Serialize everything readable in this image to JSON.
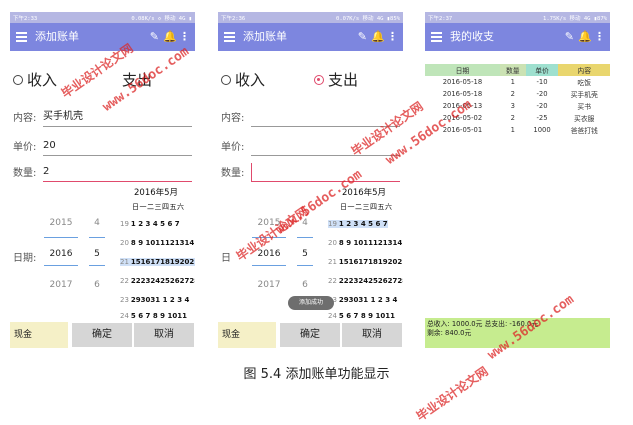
{
  "phone1": {
    "status": {
      "left": "下午2:33",
      "right": "0.08K/s ◇ 移动 4G ▮"
    },
    "title": "添加账单",
    "radio": {
      "income": "收入",
      "expense": "支出",
      "selected": "income"
    },
    "fields": {
      "content_label": "内容:",
      "content_value": "买手机壳",
      "price_label": "单价:",
      "price_value": "20",
      "qty_label": "数量:",
      "qty_value": "2"
    },
    "date_label": "日期:",
    "picker": {
      "years": [
        "2015",
        "2016",
        "2017"
      ],
      "months": [
        "4",
        "5",
        "6"
      ]
    },
    "calendar": {
      "title": "2016年5月",
      "head": "日一二三四五六",
      "rows": [
        [
          "19",
          "1 2 3 4 5 6 7"
        ],
        [
          "20",
          "8 9 1011121314"
        ],
        [
          "21",
          "15161718192021"
        ],
        [
          "22",
          "22232425262728"
        ],
        [
          "23",
          "293031 1 2 3 4"
        ],
        [
          "24",
          "5 6 7 8 9 1011"
        ]
      ]
    },
    "bottom": {
      "pay": "现金",
      "ok": "确定",
      "cancel": "取消"
    }
  },
  "phone2": {
    "status": {
      "left": "下午2:36",
      "right": "0.07K/s 移动 4G ▮85%"
    },
    "title": "添加账单",
    "radio": {
      "income": "收入",
      "expense": "支出",
      "selected": "expense"
    },
    "fields": {
      "content_label": "内容:",
      "price_label": "单价:",
      "qty_label": "数量:"
    },
    "date_label": "日",
    "picker": {
      "years": [
        "2015",
        "2016",
        "2017"
      ],
      "months": [
        "4",
        "5",
        "6"
      ]
    },
    "calendar": {
      "title": "2016年5月",
      "head": "日一二三四五六",
      "rows": [
        [
          "19",
          "1 2 3 4 5 6 7"
        ],
        [
          "20",
          "8 9 1011121314"
        ],
        [
          "21",
          "15161718192021"
        ],
        [
          "22",
          "22232425262728"
        ],
        [
          "23",
          "293031 1 2 3 4"
        ],
        [
          "24",
          "5 6 7 8 9 1011"
        ]
      ]
    },
    "toast": "添加成功",
    "bottom": {
      "pay": "现金",
      "ok": "确定",
      "cancel": "取消"
    }
  },
  "phone3": {
    "status": {
      "left": "下午2:37",
      "right": "1.75K/s 移动 4G ▮87%"
    },
    "title": "我的收支",
    "table": {
      "headers": [
        "日期",
        "数量",
        "单价",
        "内容"
      ],
      "rows": [
        [
          "2016-05-18",
          "1",
          "-10",
          "吃饭"
        ],
        [
          "2016-05-18",
          "2",
          "-20",
          "买手机壳"
        ],
        [
          "2016-05-13",
          "3",
          "-20",
          "买书"
        ],
        [
          "2016-05-02",
          "2",
          "-25",
          "买衣服"
        ],
        [
          "2016-05-01",
          "1",
          "1000",
          "爸爸打钱"
        ]
      ]
    },
    "summary": {
      "line1": "总收入: 1000.0元   总支出: -160.0元",
      "line2": "剩余: 840.0元"
    }
  },
  "caption": "图 5.4 添加账单功能显示",
  "watermarks": {
    "site": "www.56doc.com",
    "cn": "毕业设计论文网"
  }
}
